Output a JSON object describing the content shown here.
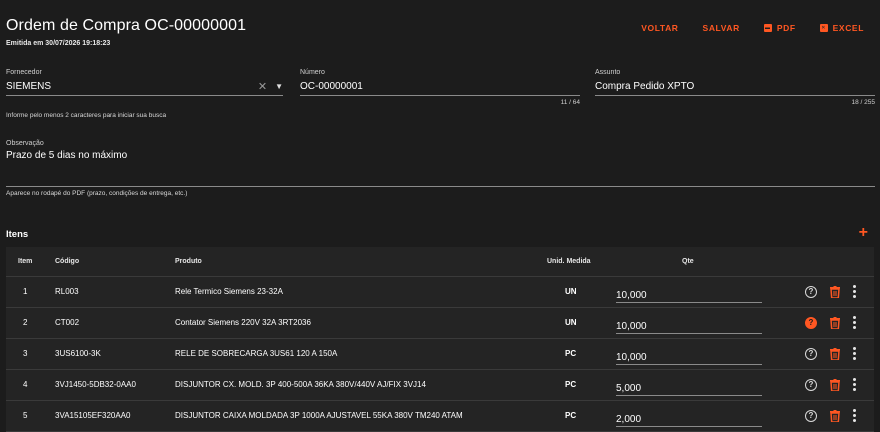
{
  "header": {
    "title": "Ordem de Compra OC-00000001",
    "subtitle": "Emitida em 30/07/2026 19:18:23"
  },
  "toolbar": {
    "back_label": "VOLTAR",
    "save_label": "SALVAR",
    "pdf_label": "PDF",
    "excel_label": "EXCEL",
    "accent_color": "#ff5722"
  },
  "form": {
    "supplier": {
      "label": "Fornecedor",
      "value": "SIEMENS",
      "hint": "Informe pelo menos 2 caracteres para iniciar sua busca"
    },
    "number": {
      "label": "Número",
      "value": "OC-00000001",
      "counter": "11 / 64"
    },
    "subject": {
      "label": "Assunto",
      "value": "Compra Pedido XPTO",
      "counter": "18 / 255"
    },
    "notes": {
      "label": "Observação",
      "value": "Prazo de 5 dias no máximo",
      "hint": "Aparece no rodapé do PDF (prazo, condições de entrega, etc.)"
    }
  },
  "items": {
    "title": "Itens",
    "add_icon": "plus-icon",
    "columns": [
      "Item",
      "Código",
      "Produto",
      "Unid. Medida",
      "Qte"
    ],
    "rows": [
      {
        "item": "1",
        "code": "RL003",
        "product": "Rele Termico Siemens 23-32A",
        "unit": "UN",
        "qty": "10,000",
        "help_alert": false
      },
      {
        "item": "2",
        "code": "CT002",
        "product": "Contator Siemens 220V 32A 3RT2036",
        "unit": "UN",
        "qty": "10,000",
        "help_alert": true
      },
      {
        "item": "3",
        "code": "3US6100-3K",
        "product": "RELE DE SOBRECARGA 3US61 120 A 150A",
        "unit": "PC",
        "qty": "10,000",
        "help_alert": false
      },
      {
        "item": "4",
        "code": "3VJ1450-5DB32-0AA0",
        "product": "DISJUNTOR CX. MOLD. 3P 400-500A 36KA 380V/440V AJ/FIX 3VJ14",
        "unit": "PC",
        "qty": "5,000",
        "help_alert": false
      },
      {
        "item": "5",
        "code": "3VA15105EF320AA0",
        "product": "DISJUNTOR CAIXA MOLDADA 3P 1000A AJUSTAVEL 55KA 380V TM240 ATAM",
        "unit": "PC",
        "qty": "2,000",
        "help_alert": false
      }
    ]
  }
}
